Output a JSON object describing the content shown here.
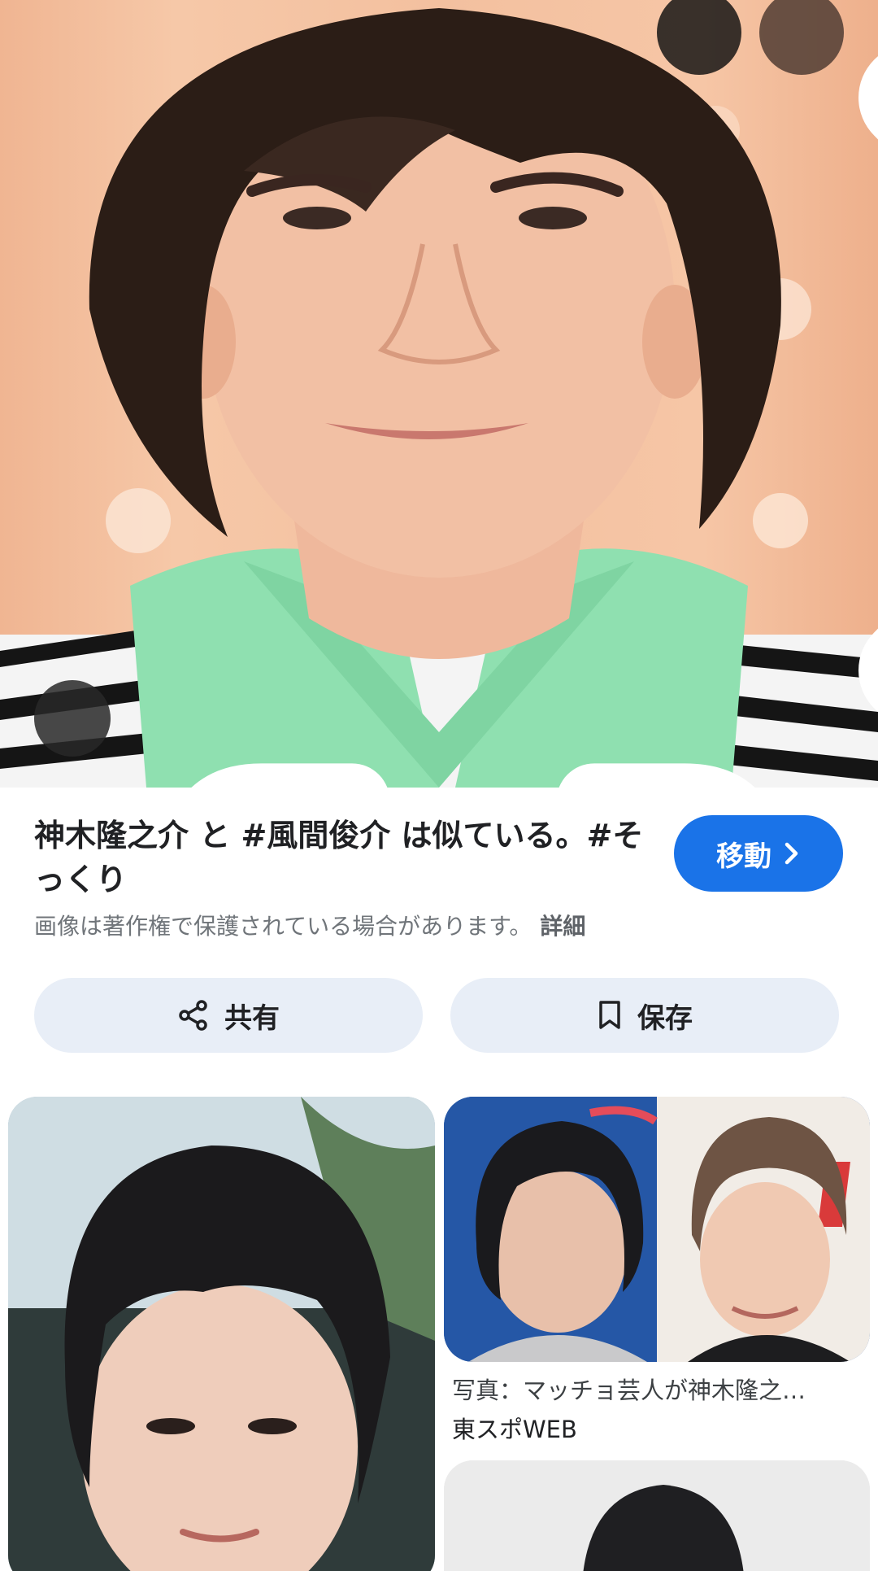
{
  "viewer": {
    "title": "神木隆之介 と #風間俊介 は似ている。#そっくり",
    "goto_label": "移動",
    "copyright_notice": "画像は著作権で保護されている場合があります。",
    "details_link": "詳細",
    "share_label": "共有",
    "save_label": "保存"
  },
  "icons": {
    "menu": "more-vert-icon",
    "close": "close-icon",
    "lens": "lens-icon",
    "share": "share-icon",
    "save": "bookmark-icon",
    "goto": "chevron-right-icon"
  },
  "results": [
    {
      "title": "",
      "source": ""
    },
    {
      "title": "写真：マッチョ芸人が神木隆之…",
      "source": "東スポWEB"
    },
    {
      "title": "",
      "source": ""
    }
  ],
  "colors": {
    "accent": "#1a73e8",
    "pill_bg": "#e8eef7",
    "shirt": "#8fe0b0"
  }
}
